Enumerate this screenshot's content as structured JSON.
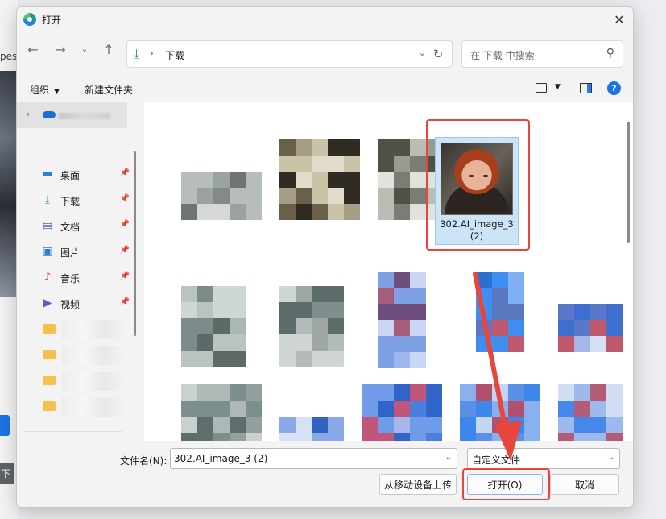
{
  "background": {
    "left_text": "pesn",
    "bottom_text": "下"
  },
  "dialog": {
    "title": "打开"
  },
  "navigation": {
    "current_folder": "下载",
    "search_placeholder": "在 下载 中搜索"
  },
  "toolbar": {
    "organize_label": "组织",
    "new_folder_label": "新建文件夹",
    "help_label": "?"
  },
  "sidebar": {
    "items": [
      {
        "label": "桌面",
        "icon": "desktop-icon"
      },
      {
        "label": "下载",
        "icon": "download-icon"
      },
      {
        "label": "文档",
        "icon": "document-icon"
      },
      {
        "label": "图片",
        "icon": "pictures-icon"
      },
      {
        "label": "音乐",
        "icon": "music-icon"
      },
      {
        "label": "视频",
        "icon": "video-icon"
      }
    ]
  },
  "files": {
    "selected_name": "302.AI_image_3 (2)"
  },
  "footer": {
    "filename_label": "文件名(N):",
    "filename_value": "302.AI_image_3 (2)",
    "filetype_value": "自定义文件",
    "upload_label": "从移动设备上传",
    "open_label": "打开(O)",
    "cancel_label": "取消"
  },
  "colors": {
    "accent": "#1a73e8",
    "annotation_red": "#e8453c",
    "selection": "#cce4f7"
  }
}
